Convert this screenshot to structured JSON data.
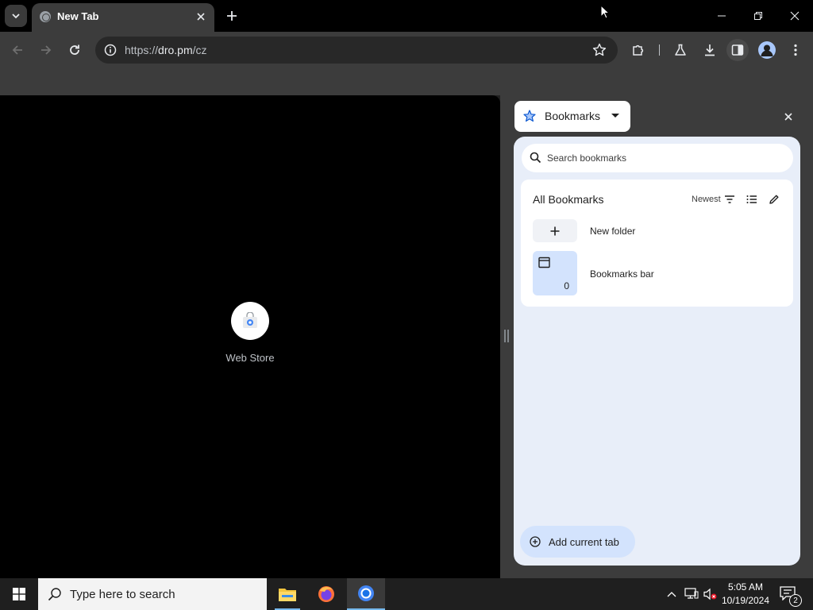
{
  "browser": {
    "tab": {
      "title": "New Tab",
      "active": true
    },
    "address_bar": {
      "url_scheme": "https://",
      "url_host": "dro.pm",
      "url_path": "/cz"
    },
    "toolbar_icons": [
      "back-icon",
      "forward-icon",
      "reload-icon",
      "site-info-icon",
      "bookmark-star-icon",
      "extensions-icon",
      "labs-icon",
      "downloads-icon",
      "side-panel-icon",
      "profile-icon",
      "menu-icon"
    ]
  },
  "new_tab_page": {
    "shortcuts": [
      {
        "label": "Web Store",
        "icon": "web-store-icon"
      }
    ]
  },
  "side_panel": {
    "selector_label": "Bookmarks",
    "search_placeholder": "Search bookmarks",
    "list_title": "All Bookmarks",
    "sort_label": "Newest",
    "rows": [
      {
        "label": "New folder",
        "icon": "plus-icon"
      },
      {
        "label": "Bookmarks bar",
        "icon": "folder-icon",
        "count": "0"
      }
    ],
    "add_button_label": "Add current tab"
  },
  "taskbar": {
    "search_placeholder": "Type here to search",
    "apps": [
      "file-explorer",
      "firefox",
      "chrome"
    ],
    "active_app": "chrome",
    "clock": {
      "time": "5:05 AM",
      "date": "10/19/2024"
    },
    "notification_count": "2"
  },
  "colors": {
    "chrome_dark": "#3c3c3c",
    "panel_bg": "#e8eef9",
    "accent_blue": "#d3e3fd",
    "taskbar_highlight": "#76b9ed"
  }
}
